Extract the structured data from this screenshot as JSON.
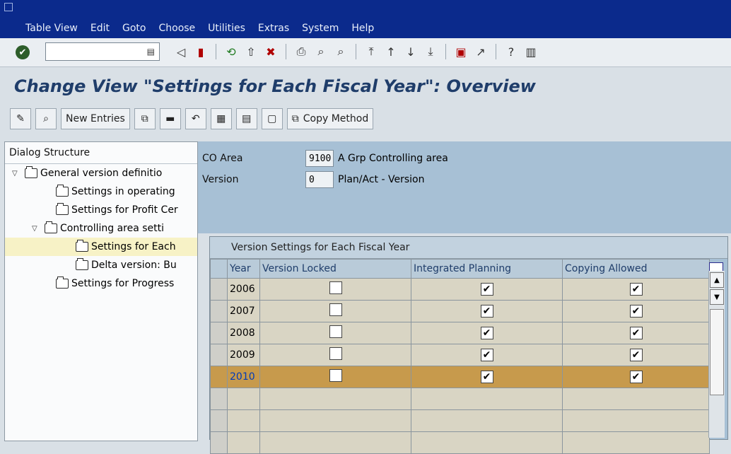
{
  "menu": {
    "items": [
      "Table View",
      "Edit",
      "Goto",
      "Choose",
      "Utilities",
      "Extras",
      "System",
      "Help"
    ]
  },
  "toolbar": {
    "command_value": "",
    "ok_icon": "check-icon"
  },
  "page": {
    "title": "Change View \"Settings for Each Fiscal Year\": Overview"
  },
  "appbar": {
    "new_entries": "New Entries",
    "copy_method": "Copy Method"
  },
  "dialog": {
    "header": "Dialog Structure",
    "items": [
      {
        "label": "General version definitio",
        "level": 0,
        "expanded": true
      },
      {
        "label": "Settings in operating",
        "level": 1
      },
      {
        "label": "Settings for Profit Cer",
        "level": 1
      },
      {
        "label": "Controlling area setti",
        "level": 1,
        "expanded": true
      },
      {
        "label": "Settings for Each",
        "level": 2,
        "selected": true
      },
      {
        "label": "Delta version: Bu",
        "level": 2
      },
      {
        "label": "Settings for Progress",
        "level": 1
      }
    ]
  },
  "header": {
    "co_area_label": "CO Area",
    "co_area_value": "9100",
    "co_area_desc": "A Grp Controlling area",
    "version_label": "Version",
    "version_value": "0",
    "version_desc": "Plan/Act - Version"
  },
  "table": {
    "title": "Version Settings for Each Fiscal Year",
    "columns": [
      "Year",
      "Version Locked",
      "Integrated Planning",
      "Copying Allowed"
    ],
    "rows": [
      {
        "year": "2006",
        "locked": false,
        "integrated": true,
        "copying": true
      },
      {
        "year": "2007",
        "locked": false,
        "integrated": true,
        "copying": true
      },
      {
        "year": "2008",
        "locked": false,
        "integrated": true,
        "copying": true
      },
      {
        "year": "2009",
        "locked": false,
        "integrated": true,
        "copying": true
      },
      {
        "year": "2010",
        "locked": false,
        "integrated": true,
        "copying": true,
        "selected": true
      }
    ],
    "empty_rows": 3
  }
}
